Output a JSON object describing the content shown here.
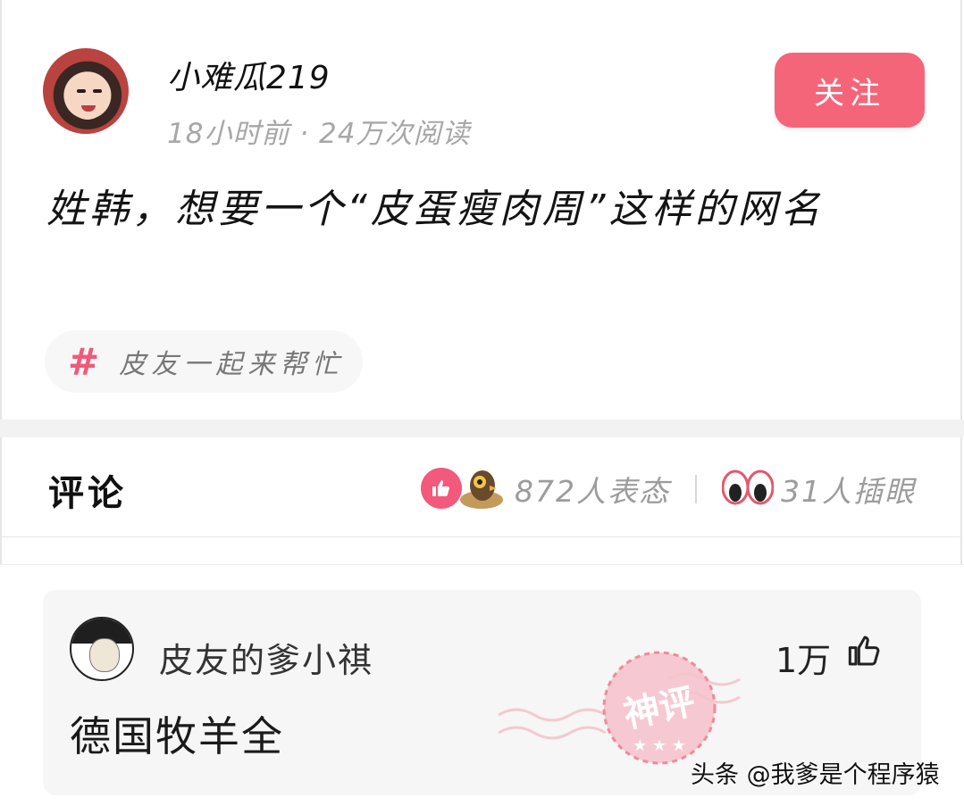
{
  "post": {
    "username": "小难瓜219",
    "meta": "18小时前 · 24万次阅读",
    "follow_label": "关注",
    "content": "姓韩，想要一个“皮蛋瘦肉周”这样的网名",
    "topic": "皮友一起来帮忙",
    "topic_icon": "#"
  },
  "stats": {
    "comments_title": "评论",
    "reactions": "872人表态",
    "eye_pokes": "31人插眼"
  },
  "comment": {
    "author": "皮友的爹小祺",
    "likes": "1万",
    "text": "德国牧羊全",
    "stamp_text": "神评",
    "stamp_color": "#f07a8c"
  },
  "watermark": "头条 @我爹是个程序猿",
  "colors": {
    "accent": "#f4657a",
    "muted": "#a7a7a7"
  }
}
